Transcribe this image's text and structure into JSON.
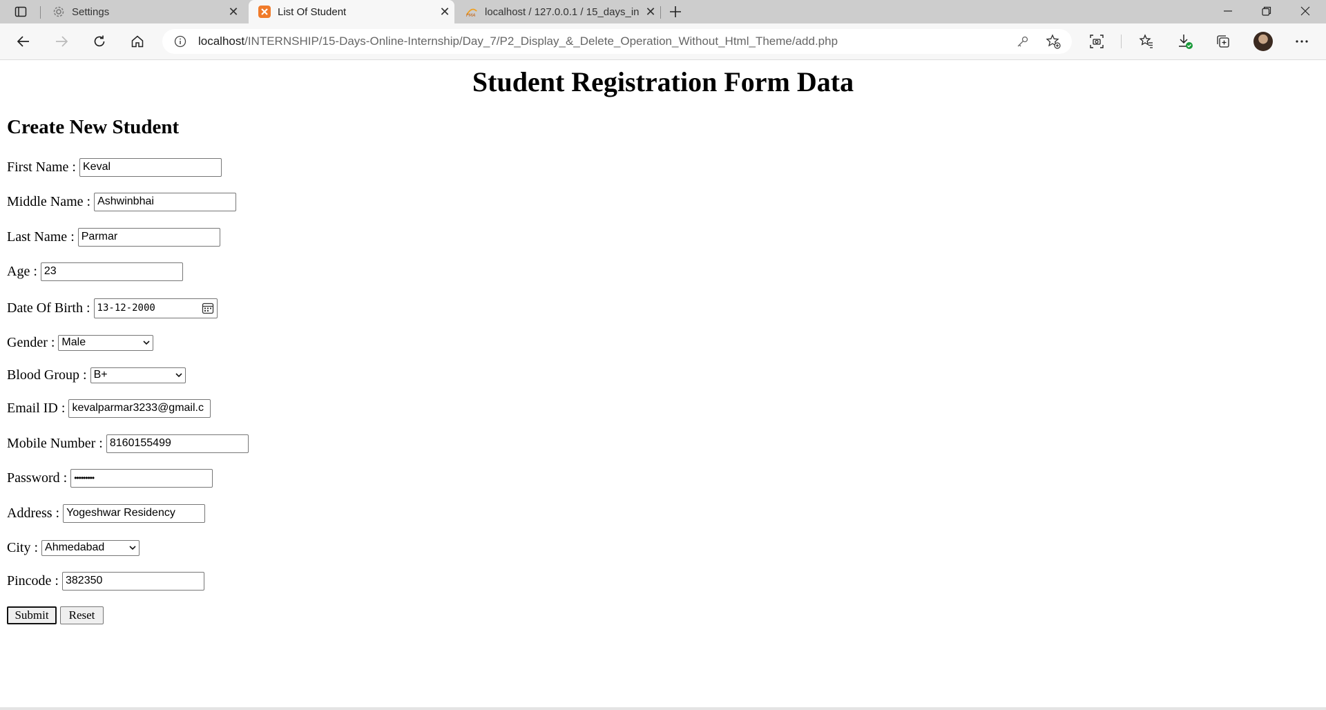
{
  "browser": {
    "tabs": [
      {
        "title": "Settings",
        "active": false,
        "icon": "gear-icon"
      },
      {
        "title": "List Of Student",
        "active": true,
        "icon": "xampp-icon"
      },
      {
        "title": "localhost / 127.0.0.1 / 15_days_in",
        "active": false,
        "icon": "phpmyadmin-icon"
      }
    ],
    "url_host": "localhost",
    "url_path": "/INTERNSHIP/15-Days-Online-Internship/Day_7/P2_Display_&_Delete_Operation_Without_Html_Theme/add.php"
  },
  "page": {
    "title": "Student Registration Form Data",
    "section_title": "Create New Student"
  },
  "form": {
    "first_name": {
      "label": "First Name :",
      "value": "Keval"
    },
    "middle_name": {
      "label": "Middle Name :",
      "value": "Ashwinbhai"
    },
    "last_name": {
      "label": "Last Name :",
      "value": "Parmar"
    },
    "age": {
      "label": "Age :",
      "value": "23"
    },
    "dob": {
      "label": "Date Of Birth :",
      "value": "13-12-2000"
    },
    "gender": {
      "label": "Gender :",
      "value": "Male"
    },
    "blood_group": {
      "label": "Blood Group :",
      "value": "B+"
    },
    "email": {
      "label": "Email ID :",
      "value": "kevalparmar3233@gmail.c"
    },
    "mobile": {
      "label": "Mobile Number :",
      "value": "8160155499"
    },
    "password": {
      "label": "Password :",
      "value": "•••••••••"
    },
    "address": {
      "label": "Address :",
      "value": "Yogeshwar Residency"
    },
    "city": {
      "label": "City :",
      "value": "Ahmedabad"
    },
    "pincode": {
      "label": "Pincode :",
      "value": "382350"
    },
    "submit_label": "Submit",
    "reset_label": "Reset"
  }
}
